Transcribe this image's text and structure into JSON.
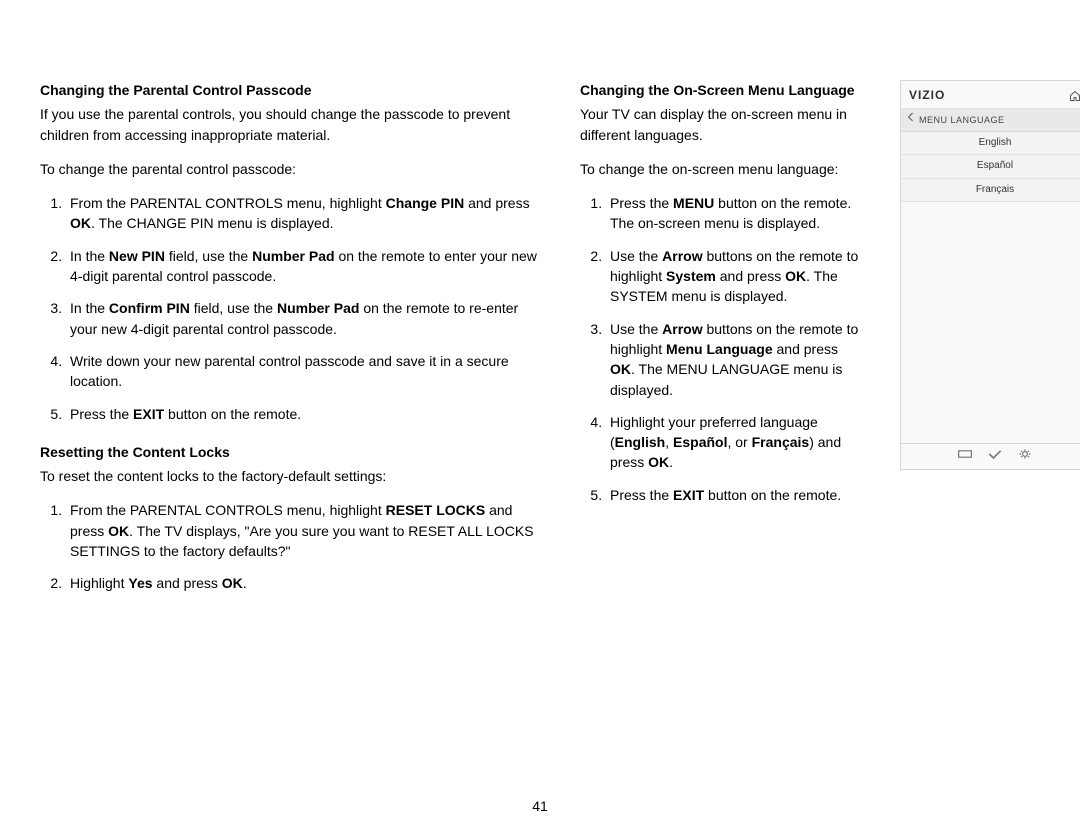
{
  "page_number": "41",
  "left": {
    "h1": "Changing the Parental Control Passcode",
    "p1": "If you use the parental controls, you should change the passcode to prevent children from accessing inappropriate material.",
    "p2": "To change the parental control passcode:",
    "s1_a": "From the PARENTAL CONTROLS menu, highlight ",
    "s1_b": "Change PIN",
    "s1_c": " and press ",
    "s1_d": "OK",
    "s1_e": ". The CHANGE PIN menu is displayed.",
    "s2_a": "In the ",
    "s2_b": "New PIN",
    "s2_c": " field, use the ",
    "s2_d": "Number Pad",
    "s2_e": " on the remote to enter your new 4-digit parental control passcode.",
    "s3_a": "In the ",
    "s3_b": "Confirm PIN",
    "s3_c": " field, use the ",
    "s3_d": "Number Pad",
    "s3_e": " on the remote to re-enter your new 4-digit parental control passcode.",
    "s4": "Write down your new parental control passcode and save it in a secure location.",
    "s5_a": "Press the ",
    "s5_b": "EXIT",
    "s5_c": " button on the remote.",
    "h2": "Resetting the Content Locks",
    "p3": "To reset the content locks to the factory-default settings:",
    "r1_a": "From the PARENTAL CONTROLS menu, highlight ",
    "r1_b": "RESET LOCKS",
    "r1_c": " and press ",
    "r1_d": "OK",
    "r1_e": ". The TV displays, \"Are you sure you want to RESET ALL LOCKS SETTINGS to the factory defaults?\"",
    "r2_a": "Highlight ",
    "r2_b": "Yes",
    "r2_c": " and press ",
    "r2_d": "OK",
    "r2_e": "."
  },
  "mid": {
    "h1": "Changing the On-Screen Menu Language",
    "p1": "Your TV can display the on-screen menu in different languages.",
    "p2": "To change the on-screen menu language:",
    "m1_a": "Press the ",
    "m1_b": "MENU",
    "m1_c": " button on the remote. The on-screen menu is displayed.",
    "m2_a": "Use the ",
    "m2_b": "Arrow",
    "m2_c": " buttons on the remote to highlight ",
    "m2_d": "System",
    "m2_e": " and press ",
    "m2_f": "OK",
    "m2_g": ". The SYSTEM menu is displayed.",
    "m3_a": "Use the ",
    "m3_b": "Arrow",
    "m3_c": " buttons on the remote to highlight ",
    "m3_d": "Menu Language",
    "m3_e": " and press ",
    "m3_f": "OK",
    "m3_g": ". The MENU LANGUAGE menu is displayed.",
    "m4_a": "Highlight your preferred language (",
    "m4_b": "English",
    "m4_c": ", ",
    "m4_d": "Español",
    "m4_e": ", or ",
    "m4_f": "Français",
    "m4_g": ") and press ",
    "m4_h": "OK",
    "m4_i": ".",
    "m5_a": "Press the ",
    "m5_b": "EXIT",
    "m5_c": " button on the remote."
  },
  "tv": {
    "brand": "VIZIO",
    "header": "MENU LANGUAGE",
    "items": [
      "English",
      "Español",
      "Français"
    ]
  }
}
